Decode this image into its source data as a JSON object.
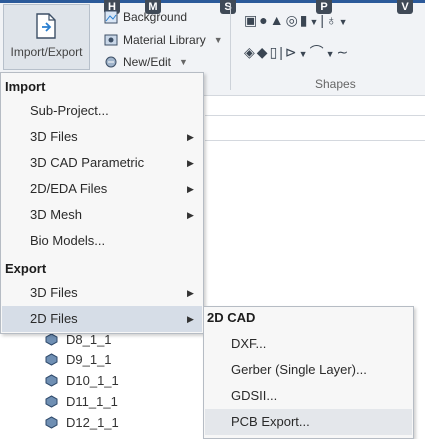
{
  "ribbon": {
    "keytips": [
      "H",
      "M",
      "S",
      "P",
      "V"
    ],
    "import_export_label": "Import/Export",
    "background_label": "Background",
    "material_library_label": "Material Library",
    "new_edit_label": "New/Edit",
    "shapes_group_label": "Shapes"
  },
  "menu": {
    "import_header": "Import",
    "import_items": [
      {
        "label": "Sub-Project...",
        "submenu": false
      },
      {
        "label": "3D Files",
        "submenu": true
      },
      {
        "label": "3D CAD Parametric",
        "submenu": true
      },
      {
        "label": "2D/EDA Files",
        "submenu": true
      },
      {
        "label": "3D Mesh",
        "submenu": true
      },
      {
        "label": "Bio Models...",
        "submenu": false
      }
    ],
    "export_header": "Export",
    "export_items": [
      {
        "label": "3D Files",
        "submenu": true
      },
      {
        "label": "2D Files",
        "submenu": true
      }
    ]
  },
  "submenu": {
    "header": "2D CAD",
    "items": [
      {
        "label": "DXF..."
      },
      {
        "label": "Gerber (Single Layer)..."
      },
      {
        "label": "GDSII..."
      },
      {
        "label": "PCB Export..."
      }
    ]
  },
  "tree": {
    "items": [
      "D8_1_1",
      "D9_1_1",
      "D10_1_1",
      "D11_1_1",
      "D12_1_1"
    ]
  },
  "colors": {
    "ribbon_bg": "#f1f3f6",
    "menu_bg": "#f7f7f7",
    "active_item": "#d6dde7",
    "hover_item": "#e4e7eb"
  }
}
